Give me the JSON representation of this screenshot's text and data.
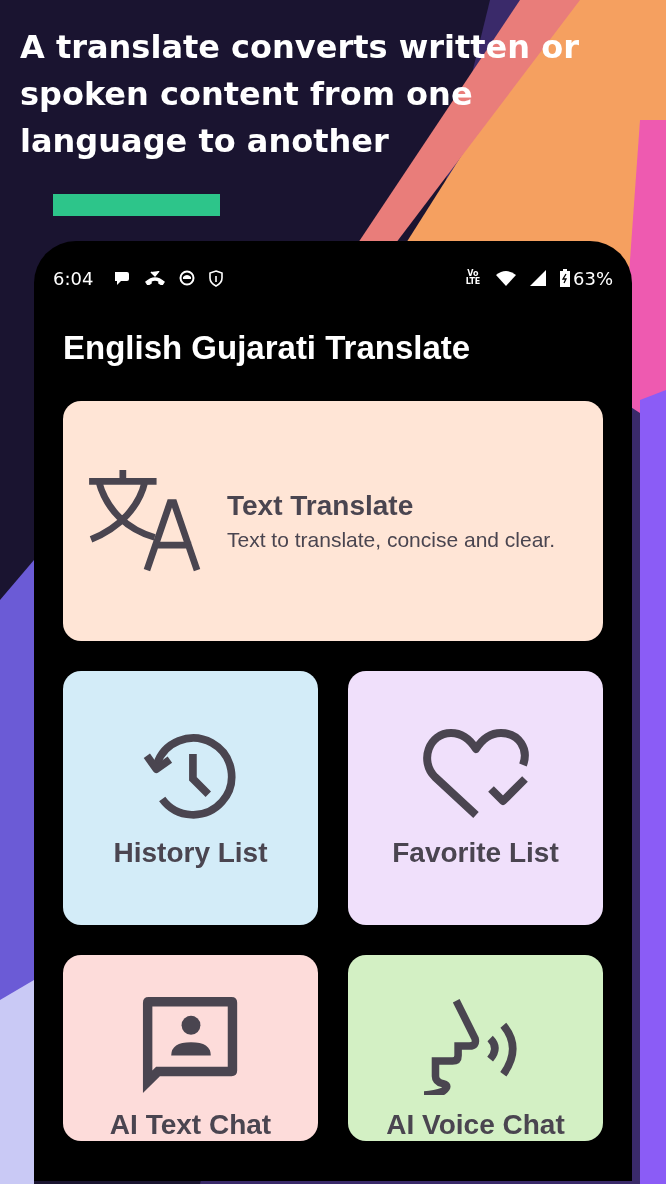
{
  "headline": "A translate converts written or spoken content from one language to another",
  "status_bar": {
    "time": "6:04",
    "network": "Vo LTE",
    "battery": "63%"
  },
  "app_title": "English Gujarati Translate",
  "cards": [
    {
      "kind": "translate",
      "title": "Text Translate",
      "description": "Text to translate, concise and clear.",
      "color": "#ffe5d6"
    },
    {
      "kind": "history",
      "title": "History List",
      "color": "#d3ecf8"
    },
    {
      "kind": "favorite",
      "title": "Favorite List",
      "color": "#f0e0fb"
    },
    {
      "kind": "text-chat",
      "title": "AI Text Chat",
      "color": "#fddcda"
    },
    {
      "kind": "voice-chat",
      "title": "AI Voice Chat",
      "color": "#d3f0c4"
    }
  ]
}
